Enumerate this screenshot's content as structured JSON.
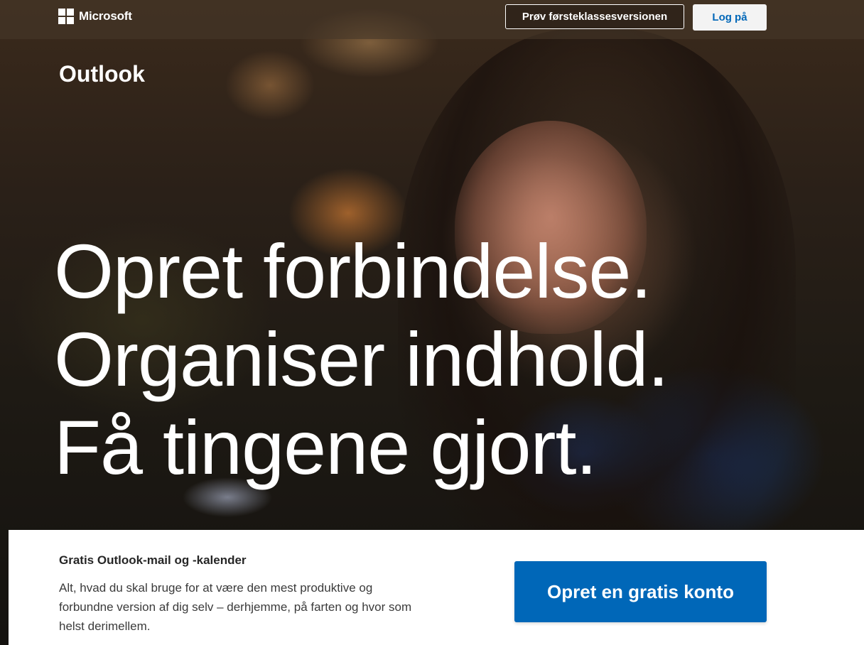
{
  "header": {
    "brand": "Microsoft",
    "premium_button": "Prøv førsteklassesversionen",
    "login_button": "Log på"
  },
  "product": {
    "name": "Outlook"
  },
  "hero": {
    "headline_lines": [
      "Opret forbindelse.",
      "Organiser indhold.",
      "Få tingene gjort."
    ]
  },
  "panel": {
    "heading": "Gratis Outlook-mail og -kalender",
    "text": "Alt, hvad du skal bruge for at være den mest produktive og forbundne version af dig selv – derhjemme, på farten og hvor som helst derimellem.",
    "cta_button": "Opret en gratis konto"
  },
  "colors": {
    "accent_blue": "#0067b8",
    "panel_bg": "#ffffff",
    "login_bg": "#f3f3f3"
  },
  "icons": {
    "brand_logo": "microsoft-logo-icon"
  }
}
